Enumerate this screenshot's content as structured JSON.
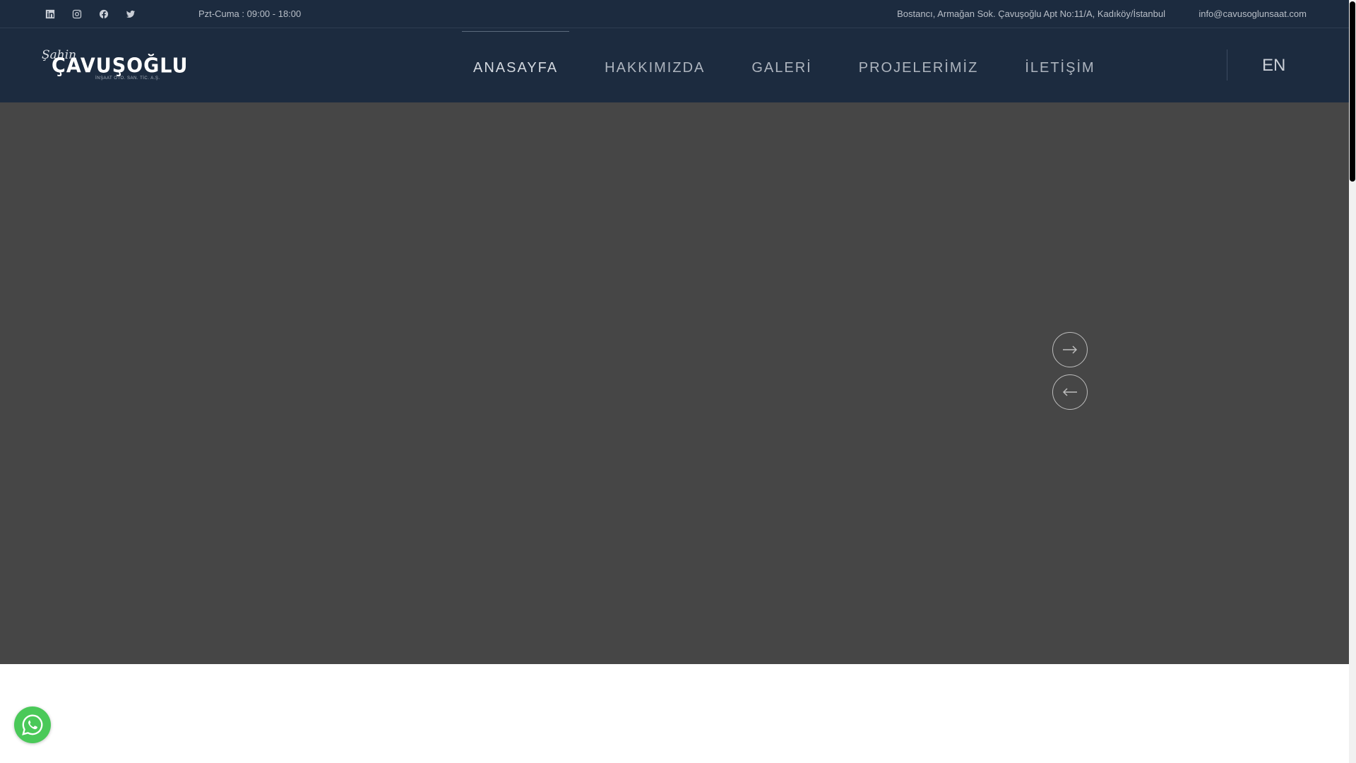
{
  "topbar": {
    "social": [
      "linkedin-icon",
      "instagram-icon",
      "facebook-icon",
      "twitter-icon"
    ],
    "hours": "Pzt-Cuma : 09:00 - 18:00",
    "address": "Bostancı, Armağan Sok. Çavuşoğlu Apt No:11/A, Kadıköy/İstanbul",
    "email": "info@cavusoglunsaat.com"
  },
  "header": {
    "logo": {
      "script": "Şahin",
      "main": "ÇAVUŞOĞLU",
      "sub": "İNŞAAT OTO. SAN. TİC. A.Ş."
    },
    "nav": [
      {
        "label": "ANASAYFA",
        "active": true
      },
      {
        "label": "HAKKIMIZDA",
        "active": false
      },
      {
        "label": "GALERİ",
        "active": false
      },
      {
        "label": "PROJELERİMİZ",
        "active": false
      },
      {
        "label": "İLETİŞİM",
        "active": false
      }
    ],
    "language": "EN"
  },
  "hero": {
    "next_icon": "arrow-right-icon",
    "prev_icon": "arrow-left-icon"
  },
  "whatsapp_icon": "whatsapp-icon",
  "colors": {
    "header_bg": "#1c2b3f",
    "hero_bg": "#464646",
    "whatsapp": "#4ac959"
  }
}
